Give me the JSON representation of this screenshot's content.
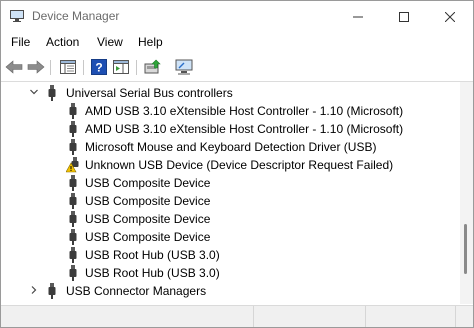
{
  "window": {
    "title": "Device Manager"
  },
  "menu": [
    "File",
    "Action",
    "View",
    "Help"
  ],
  "toolbar": [
    {
      "name": "back-arrow-icon"
    },
    {
      "name": "forward-arrow-icon"
    },
    {
      "name": "properties-pane-icon"
    },
    {
      "name": "help-icon"
    },
    {
      "name": "action-pane-icon"
    },
    {
      "name": "update-driver-icon"
    },
    {
      "name": "scan-hardware-icon"
    }
  ],
  "tree": {
    "category": "Universal Serial Bus controllers",
    "devices": [
      {
        "label": "AMD USB 3.10 eXtensible Host Controller - 1.10 (Microsoft)",
        "warning": false
      },
      {
        "label": "AMD USB 3.10 eXtensible Host Controller - 1.10 (Microsoft)",
        "warning": false
      },
      {
        "label": "Microsoft Mouse and Keyboard Detection Driver (USB)",
        "warning": false
      },
      {
        "label": "Unknown USB Device (Device Descriptor Request Failed)",
        "warning": true
      },
      {
        "label": "USB Composite Device",
        "warning": false
      },
      {
        "label": "USB Composite Device",
        "warning": false
      },
      {
        "label": "USB Composite Device",
        "warning": false
      },
      {
        "label": "USB Composite Device",
        "warning": false
      },
      {
        "label": "USB Root Hub (USB 3.0)",
        "warning": false
      },
      {
        "label": "USB Root Hub (USB 3.0)",
        "warning": false
      }
    ],
    "next_category": "USB Connector Managers"
  },
  "colors": {
    "usb_icon": "#3c3c3c",
    "warning": "#f2c200",
    "help_icon": "#1e4fb3",
    "accent": "#2a6fc9"
  }
}
